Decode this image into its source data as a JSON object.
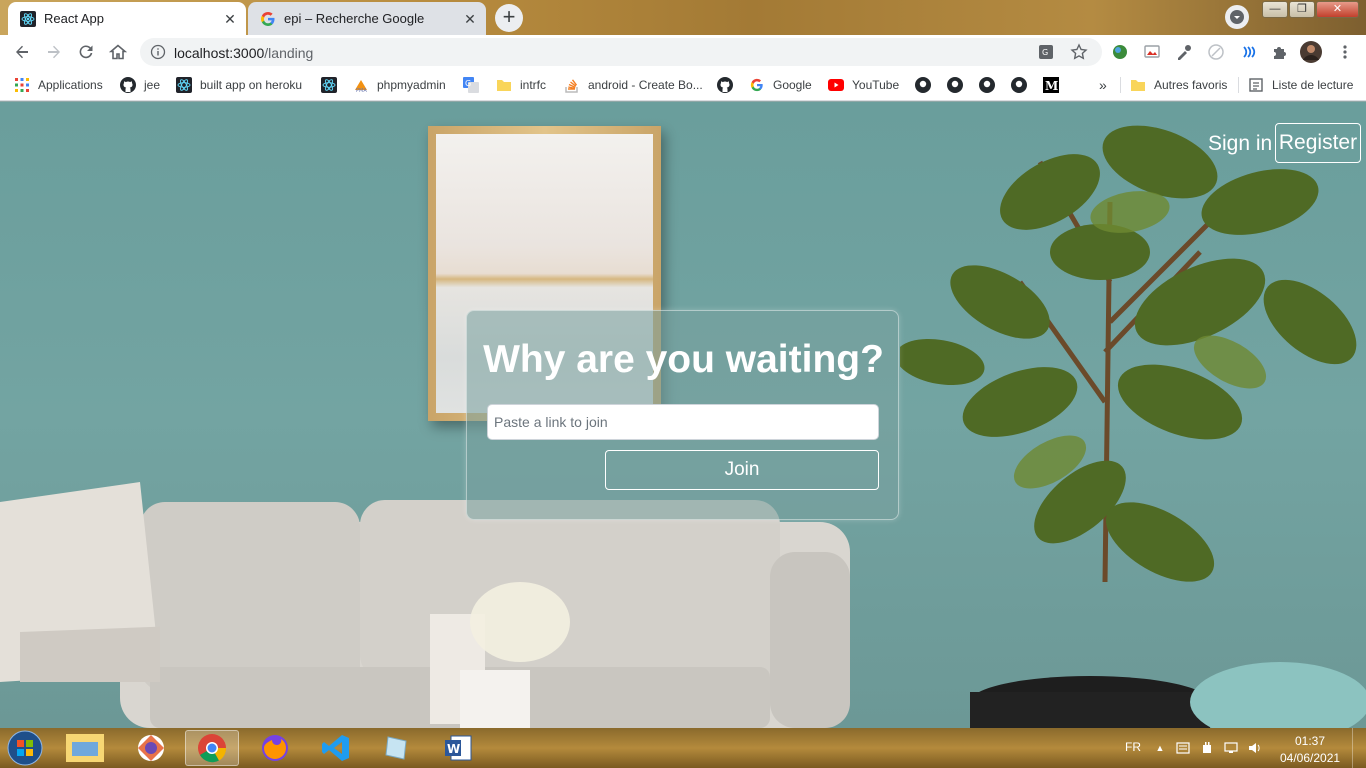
{
  "tabs": [
    {
      "title": "React App",
      "icon": "react-icon"
    },
    {
      "title": "epi – Recherche Google",
      "icon": "google-icon"
    }
  ],
  "address": {
    "host": "localhost:3000",
    "path": "/landing"
  },
  "bookmarks": {
    "items": [
      {
        "label": "Applications",
        "icon": "apps-grid-icon"
      },
      {
        "label": "jee",
        "icon": "github-icon"
      },
      {
        "label": "built app on heroku",
        "icon": "react-icon"
      },
      {
        "label": "phpmyadmin",
        "icon": "phpmyadmin-icon"
      },
      {
        "label": "intrfc",
        "icon": "folder-icon"
      },
      {
        "label": "android - Create Bo...",
        "icon": "stackoverflow-icon"
      },
      {
        "label": "Google",
        "icon": "google-icon"
      },
      {
        "label": "YouTube",
        "icon": "youtube-icon"
      }
    ],
    "more": "»",
    "other": "Autres favoris",
    "reading_list": "Liste de lecture"
  },
  "auth": {
    "sign_in": "Sign in",
    "register": "Register"
  },
  "card": {
    "title": "Why are you waiting?",
    "input_placeholder": "Paste a link to join",
    "join_label": "Join"
  },
  "taskbar": {
    "lang": "FR",
    "time": "01:37",
    "date": "04/06/2021"
  },
  "colors": {
    "overlay": "#78a09e",
    "accent_white": "#ffffff",
    "youtube": "#ff0000"
  }
}
